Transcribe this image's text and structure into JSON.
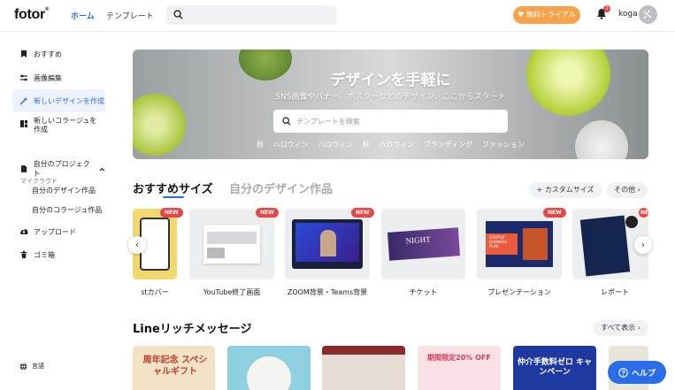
{
  "header": {
    "logo": "fotor",
    "nav_home": "ホーム",
    "nav_templates": "テンプレート",
    "trial_button": "無料トライアル",
    "notification_count": "1",
    "username": "koga"
  },
  "sidebar": {
    "items": [
      {
        "label": "おすすめ",
        "icon": "bookmark-icon"
      },
      {
        "label": "画像編集",
        "icon": "sliders-icon"
      },
      {
        "label": "新しいデザインを作成",
        "icon": "magic-wand-icon"
      },
      {
        "label": "新しいコラージュを作成",
        "icon": "collage-icon"
      }
    ],
    "section_label": "マイクラウド",
    "projects_label": "自分のプロジェクト",
    "sub_items": [
      "自分のデザイン作品",
      "自分のコラージュ作品"
    ],
    "upload_label": "アップロード",
    "trash_label": "ゴミ箱",
    "language_label": "言語"
  },
  "hero": {
    "title": "デザインを手軽に",
    "subtitle": "SNS画像やバナー、ポスターなどのデザイン、ここからスタート",
    "search_placeholder": "テンプレートを検索",
    "tags": [
      "秋",
      "ハロウィン",
      "ハロウィン",
      "秋",
      "ハロウィン",
      "ブランディング",
      "ファッション"
    ]
  },
  "recommended": {
    "tab_active": "おすすめサイズ",
    "tab_inactive": "自分のデザイン作品",
    "custom_size_button": "カスタムサイズ",
    "more_button": "その他",
    "cards": [
      {
        "label": "stカバー",
        "badge": "NEW"
      },
      {
        "label": "YouTube終了画面",
        "badge": "NEW"
      },
      {
        "label": "ZOOM背景・Teams背景",
        "badge": "NEW"
      },
      {
        "label": "チケット",
        "badge": ""
      },
      {
        "label": "プレゼンテーション",
        "badge": "NEW"
      },
      {
        "label": "レポート",
        "badge": "NEW"
      }
    ],
    "card3_text": "NIGHT",
    "card5_text": "STARTUP BUSINESS PLAN"
  },
  "line_section": {
    "title": "Lineリッチメッセージ",
    "all_button": "すべて表示",
    "card1_text": "周年記念 スペシャルギフト",
    "card4_text": "期間限定20% OFF",
    "card5_text": "仲介手数料ゼロ キャンペーン"
  },
  "help_button": "ヘルプ",
  "colors": {
    "accent": "#2b6de8",
    "trial": "#f6a24a",
    "badge": "#e84545"
  }
}
